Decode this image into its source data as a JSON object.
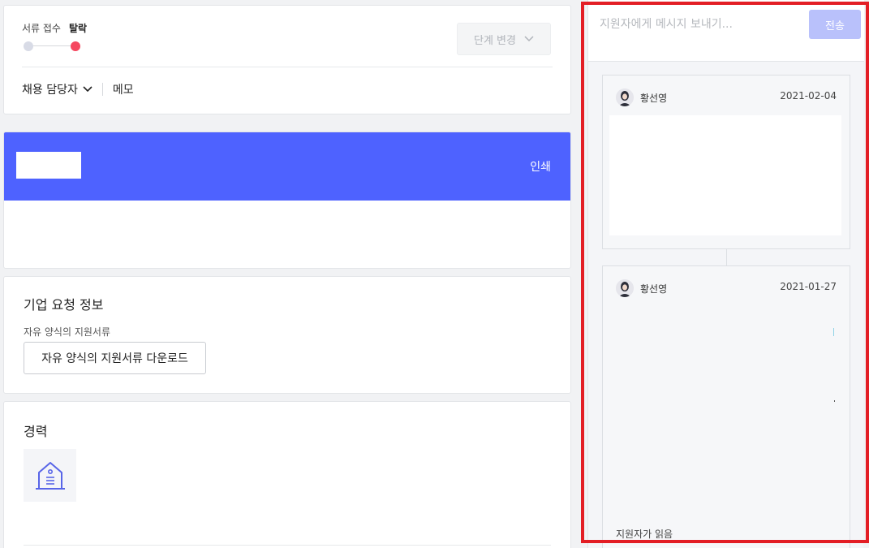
{
  "stage": {
    "steps": [
      "서류 접수",
      "탈락"
    ],
    "change_button": "단계 변경",
    "colors": {
      "inactive": "#d8dbe6",
      "active": "#f5475f"
    }
  },
  "meta_row": {
    "manager_label": "채용 담당자",
    "memo_label": "메모"
  },
  "document": {
    "print_label": "인쇄",
    "header_color": "#4e62ff"
  },
  "company_request": {
    "title": "기업 요청 정보",
    "subtitle": "자유 양식의 지원서류",
    "download_button": "자유 양식의 지원서류 다운로드"
  },
  "career": {
    "title": "경력",
    "logo_icon": "company-building-icon"
  },
  "messages": {
    "input_placeholder": "지원자에게 메시지 보내기...",
    "send_label": "전송",
    "send_color": "#b9c1fb",
    "items": [
      {
        "author": "황선영",
        "date": "2021-02-04"
      },
      {
        "author": "황선영",
        "date": "2021-01-27",
        "status": "지원자가 읽음"
      }
    ]
  },
  "annotation": {
    "color": "#e31e25"
  }
}
